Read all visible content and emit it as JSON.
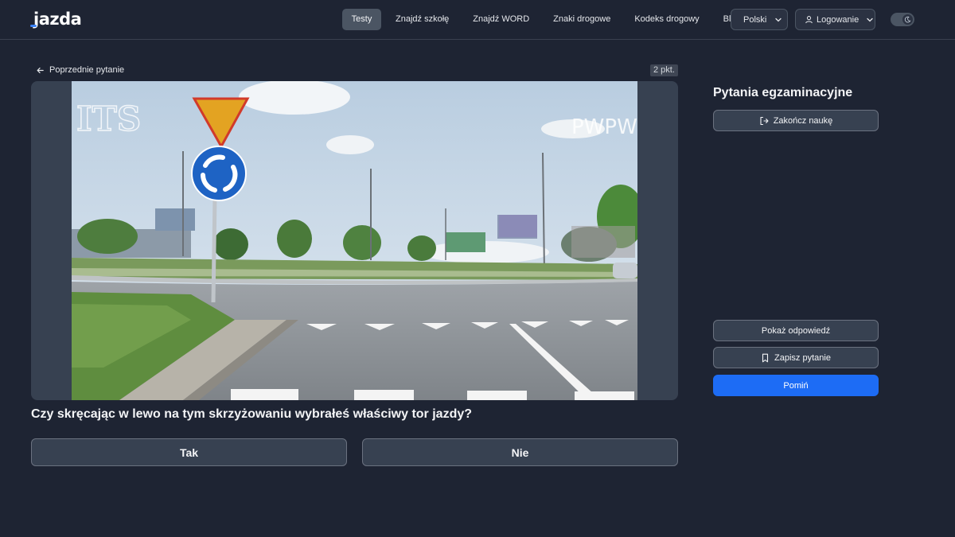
{
  "header": {
    "logo": "jazda",
    "nav": [
      {
        "label": "Testy",
        "active": true
      },
      {
        "label": "Znajdź szkołę"
      },
      {
        "label": "Znajdź WORD"
      },
      {
        "label": "Znaki drogowe"
      },
      {
        "label": "Kodeks drogowy"
      },
      {
        "label": "Blog"
      }
    ],
    "language": {
      "label": "Polski",
      "icon": "chevron-down-icon"
    },
    "login": {
      "label": "Logowanie",
      "icon": "user-icon"
    },
    "theme_toggle": {
      "icon": "moon-icon"
    }
  },
  "main": {
    "prev_question": "Poprzednie pytanie",
    "points": "2 pkt.",
    "watermarks": {
      "left": "ITS",
      "right": "PWPW"
    },
    "question": "Czy skręcając w lewo na tym skrzyżowaniu wybrałeś właściwy tor jazdy?",
    "answers": {
      "yes": "Tak",
      "no": "Nie"
    }
  },
  "sidebar": {
    "title": "Pytania egzaminacyjne",
    "finish": "Zakończ naukę",
    "show_answer": "Pokaż odpowiedź",
    "save_question": "Zapisz pytanie",
    "skip": "Pomiń"
  },
  "colors": {
    "background": "#1e2433",
    "accent": "#1d6cf5",
    "panel": "#374151"
  }
}
